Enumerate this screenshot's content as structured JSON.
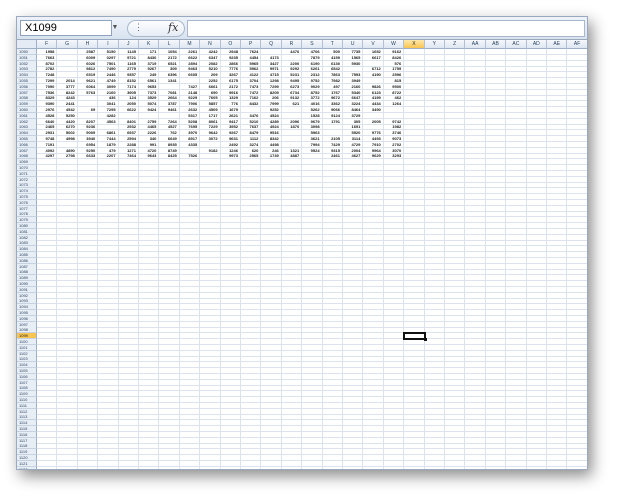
{
  "name_box": {
    "value": "X1099"
  },
  "formula_bar": {
    "fx_label": "fx",
    "formula": ""
  },
  "columns": [
    "F",
    "G",
    "H",
    "I",
    "J",
    "K",
    "L",
    "M",
    "N",
    "O",
    "P",
    "Q",
    "R",
    "S",
    "T",
    "U",
    "V",
    "W",
    "X",
    "Y",
    "Z",
    "AA",
    "AB",
    "AC",
    "AD",
    "AE",
    "AF"
  ],
  "active_column": "X",
  "first_row": 1050,
  "last_row": 1123,
  "active_row": 1099,
  "sample_rows": [
    {
      "row": 1050,
      "cells": [
        "1958",
        "",
        "2587",
        "5150",
        "1145",
        "171",
        "1054",
        "2261",
        "4242",
        "2948",
        "7624",
        "",
        "4476",
        "4706",
        "500",
        "7735",
        "1652",
        "9162"
      ]
    },
    {
      "row": 1051,
      "cells": [
        "7663",
        "",
        "6009",
        "0297",
        "9721",
        "8430",
        "2172",
        "6622",
        "6347",
        "9235",
        "4454",
        "4173",
        "",
        "7879",
        "4159",
        "1565",
        "6617",
        "8426"
      ]
    },
    {
      "row": 1052,
      "cells": [
        "8702",
        "",
        "6026",
        "7501",
        "1165",
        "3719",
        "6521",
        "2894",
        "2082",
        "2866",
        "5965",
        "3427",
        "2200",
        "6190",
        "6130",
        "5930",
        "",
        "576"
      ]
    },
    {
      "row": 1053,
      "cells": [
        "2782",
        "",
        "9812",
        "7490",
        "2779",
        "9267",
        "309",
        "9463",
        "5210",
        "7776",
        "5962",
        "9971",
        "9292",
        "6261",
        "6542",
        "",
        "6712",
        "1759"
      ]
    },
    {
      "row": 1054,
      "cells": [
        "7248",
        "",
        "6519",
        "2446",
        "9357",
        "249",
        "6396",
        "6605",
        "209",
        "3267",
        "4122",
        "4715",
        "5231",
        "2312",
        "7863",
        "7593",
        "4190",
        "2596"
      ]
    },
    {
      "row": 1055,
      "cells": [
        "7299",
        "2014",
        "9621",
        "4749",
        "8152",
        "6561",
        "1341",
        "",
        "2252",
        "6175",
        "3704",
        "1298",
        "9495",
        "9752",
        "7982",
        "3949",
        "",
        "815"
      ]
    },
    {
      "row": 1056,
      "cells": [
        "7090",
        "3777",
        "6064",
        "3099",
        "7174",
        "9653",
        "",
        "7427",
        "6661",
        "2172",
        "7473",
        "7299",
        "6273",
        "9029",
        "497",
        "2160",
        "9826",
        "9500"
      ]
    },
    {
      "row": 1057,
      "cells": [
        "7536",
        "8242",
        "5763",
        "2160",
        "3905",
        "7373",
        "7081",
        "2148",
        "690",
        "9916",
        "7472",
        "8209",
        "6734",
        "8752",
        "1767",
        "5340",
        "6123",
        "8722"
      ]
    },
    {
      "row": 1058,
      "cells": [
        "8329",
        "4243",
        "",
        "436",
        "124",
        "3529",
        "2664",
        "9229",
        "7605",
        "1329",
        "7162",
        "206",
        "9132",
        "3772",
        "9672",
        "6647",
        "4199",
        "462"
      ]
    },
    {
      "row": 1059,
      "cells": [
        "9390",
        "2441",
        "",
        "3041",
        "2050",
        "5074",
        "3787",
        "7906",
        "5857",
        "776",
        "8432",
        "7999",
        "621",
        "4016",
        "3362",
        "3224",
        "4434",
        "1264"
      ]
    },
    {
      "row": 1060,
      "cells": [
        "2976",
        "4542",
        "69",
        "7295",
        "6622",
        "9424",
        "9461",
        "2632",
        "4509",
        "1679",
        "",
        "9252",
        "",
        "5262",
        "9066",
        "8464",
        "3490",
        ""
      ]
    },
    {
      "row": 1061,
      "cells": [
        "4528",
        "5250",
        "",
        "4282",
        "",
        "",
        "",
        "5317",
        "1717",
        "2621",
        "3476",
        "4524",
        "",
        "1528",
        "9124",
        "3729",
        "",
        ""
      ]
    },
    {
      "row": 1062,
      "cells": [
        "6640",
        "4420",
        "8207",
        "4563",
        "8401",
        "2759",
        "7264",
        "5208",
        "8061",
        "9417",
        "5210",
        "4289",
        "2096",
        "9679",
        "1791",
        "305",
        "2005",
        "9742"
      ]
    },
    {
      "row": 1063,
      "cells": [
        "2465",
        "6270",
        "9236",
        "",
        "2932",
        "4465",
        "4527",
        "7695",
        "7229",
        "3952",
        "7637",
        "4924",
        "1870",
        "3098",
        "",
        "1691",
        "",
        "1982"
      ]
    },
    {
      "row": 1064,
      "cells": [
        "2931",
        "5002",
        "9009",
        "6861",
        "6937",
        "2226",
        "762",
        "3970",
        "9642",
        "9267",
        "8479",
        "9516",
        "",
        "5963",
        "",
        "5520",
        "9776",
        "3746"
      ]
    },
    {
      "row": 1065,
      "cells": [
        "9748",
        "4998",
        "3940",
        "7444",
        "2594",
        "340",
        "6649",
        "8917",
        "3072",
        "9631",
        "1112",
        "8342",
        "",
        "3621",
        "2105",
        "3114",
        "4493",
        "9073"
      ]
    },
    {
      "row": 1066,
      "cells": [
        "7191",
        "",
        "6954",
        "1879",
        "2288",
        "991",
        "8935",
        "4335",
        "",
        "2492",
        "3274",
        "4498",
        "",
        "7994",
        "7429",
        "4729",
        "7910",
        "2702"
      ]
    },
    {
      "row": 1067,
      "cells": [
        "4092",
        "4890",
        "9250",
        "479",
        "1271",
        "4720",
        "8749",
        "",
        "9182",
        "1246",
        "620",
        "246",
        "1321",
        "9524",
        "9315",
        "2004",
        "9964",
        "3070"
      ]
    },
    {
      "row": 1068,
      "cells": [
        "4297",
        "2798",
        "6633",
        "2207",
        "7464",
        "9643",
        "8425",
        "7526",
        "",
        "9973",
        "2565",
        "1749",
        "4887",
        "",
        "2461",
        "4627",
        "9629",
        "3293"
      ]
    }
  ]
}
